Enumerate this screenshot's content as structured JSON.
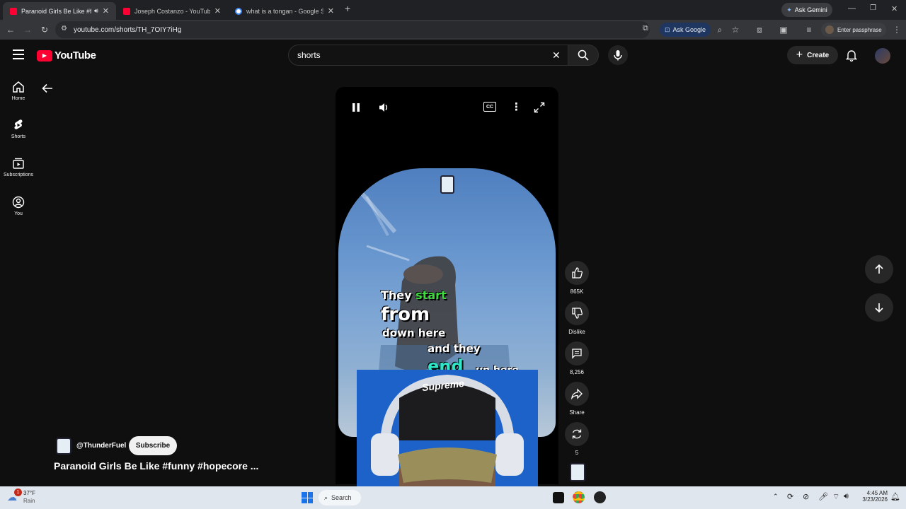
{
  "browser": {
    "tabs": [
      {
        "title": "Paranoid Girls Be Like #funn",
        "active": true,
        "favicon_color": "#ff0033"
      },
      {
        "title": "Joseph Costanzo - YouTube",
        "active": false,
        "favicon_color": "#ff0033"
      },
      {
        "title": "what is a tongan - Google Sear",
        "active": false,
        "favicon_color": "#4285f4"
      }
    ],
    "new_tab_label": "+",
    "ask_gemini": "Ask Gemini",
    "url": "youtube.com/shorts/TH_7OIY7iHg",
    "ask_google": "Ask Google",
    "passphrase": "Enter passphrase"
  },
  "youtube": {
    "logo_text": "YouTube",
    "search": {
      "value": "shorts"
    },
    "create_label": "Create",
    "sidebar": [
      {
        "label": "Home",
        "icon": "home-icon"
      },
      {
        "label": "Shorts",
        "icon": "shorts-icon"
      },
      {
        "label": "Subscriptions",
        "icon": "subscriptions-icon"
      },
      {
        "label": "You",
        "icon": "you-icon"
      }
    ],
    "video": {
      "captions": [
        "They",
        "start",
        "from",
        "down here",
        "and they",
        "end",
        "up here"
      ],
      "overlay_hat_text": "Supreme"
    },
    "actions": {
      "likes": "865K",
      "dislike": "Dislike",
      "comments": "8,256",
      "share": "Share",
      "remix": "5"
    },
    "channel": {
      "handle": "@ThunderFuel",
      "subscribe": "Subscribe"
    },
    "title": "Paranoid Girls Be Like #funny #hopecore ..."
  },
  "taskbar": {
    "weather_temp": "37°F",
    "weather_desc": "Rain",
    "weather_badge": "1",
    "search_label": "Search",
    "time": "4:45 AM",
    "date": "3/23/2026"
  },
  "colors": {
    "youtube_red": "#ff0033",
    "caption_green": "#3ddc3d",
    "caption_cyan": "#2ee6c8"
  }
}
